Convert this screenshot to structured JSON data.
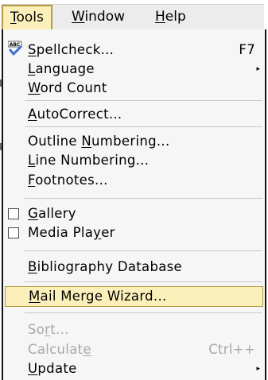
{
  "menubar": {
    "tools": {
      "mnemonic": "T",
      "rest": "ools"
    },
    "window": {
      "mnemonic": "W",
      "rest": "indow"
    },
    "help": {
      "mnemonic": "H",
      "rest": "elp"
    }
  },
  "tools_menu": {
    "spellcheck": {
      "mnemonic": "S",
      "rest": "pellcheck...",
      "shortcut": "F7",
      "icon": "spellcheck-icon"
    },
    "language": {
      "mnemonic": "L",
      "rest": "anguage"
    },
    "word_count": {
      "mnemonic": "W",
      "rest": "ord Count"
    },
    "autocorrect": {
      "mnemonic": "A",
      "rest": "utoCorrect..."
    },
    "outline_numbering": {
      "pre": "Outline ",
      "mnemonic": "N",
      "rest": "umbering..."
    },
    "line_numbering": {
      "mnemonic": "L",
      "rest": "ine Numbering..."
    },
    "footnotes": {
      "mnemonic": "F",
      "rest": "ootnotes..."
    },
    "gallery": {
      "mnemonic": "G",
      "rest": "allery",
      "checked": false
    },
    "media_player": {
      "pre": "Media Pla",
      "mnemonic": "y",
      "rest": "er",
      "checked": false
    },
    "bibliography": {
      "mnemonic": "B",
      "rest": "ibliography Database"
    },
    "mail_merge": {
      "mnemonic": "M",
      "rest": "ail Merge Wizard..."
    },
    "sort": {
      "pre": "So",
      "mnemonic": "r",
      "rest": "t..."
    },
    "calculate": {
      "pre": "Calculat",
      "mnemonic": "e",
      "rest": "",
      "shortcut": "Ctrl++"
    },
    "update": {
      "mnemonic": "U",
      "rest": "pdate"
    }
  },
  "colors": {
    "highlight": "#fcf0ba",
    "highlight_border": "#b59a43",
    "disabled_text": "#a8a8a8",
    "menu_bg": "#f6f6f6"
  }
}
